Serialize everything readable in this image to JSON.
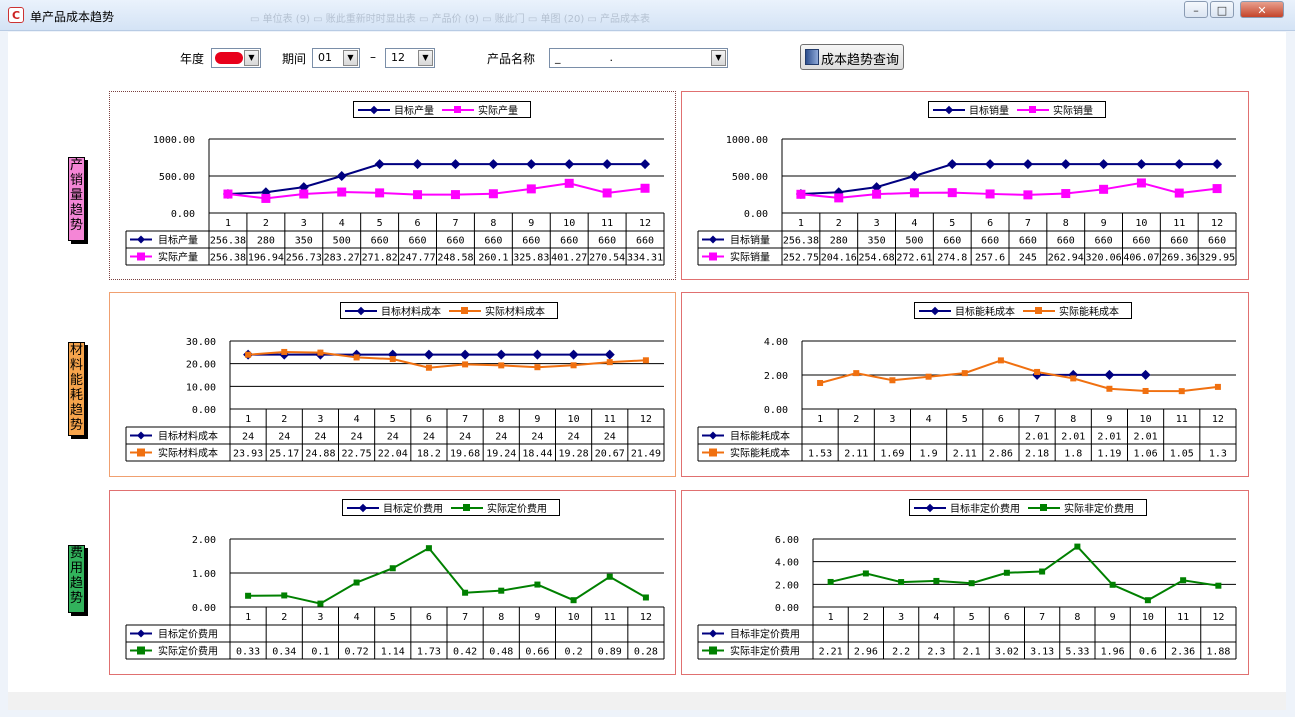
{
  "window": {
    "title": "单产品成本趋势",
    "title_icon": "app-icon",
    "bg_tabs": "▭ 单位表 (9)     ▭ 账此重新时时显出表     ▭ 产品价 (9)     ▭ 账此门     ▭ 单图 (20)     ▭ 产品成本表"
  },
  "filters": {
    "year_label": "年度",
    "period_label": "期间",
    "period_from": "01",
    "period_sep": "–",
    "period_to": "12",
    "product_label": "产品名称",
    "product_value": "_              .",
    "query_button": "成本趋势查询",
    "year_color": "#e8001b"
  },
  "sections": [
    {
      "label": "产\n销\n量\n趋\n势",
      "color": "#f486d6"
    },
    {
      "label": "材\n料\n能\n耗\n趋\n势",
      "color": "#f6a44c"
    },
    {
      "label": "费\n用\n趋\n势",
      "color": "#32b35c"
    }
  ],
  "panels": [
    {
      "id": "production",
      "border_color": "#7a4040",
      "dotted": true,
      "legend": [
        "目标产量",
        "实际产量"
      ],
      "chart_data": {
        "type": "line",
        "categories": [
          "1",
          "2",
          "3",
          "4",
          "5",
          "6",
          "7",
          "8",
          "9",
          "10",
          "11",
          "12"
        ],
        "yticks": [
          "1000.00",
          "500.00",
          "0.00"
        ],
        "ylim": [
          0,
          1000
        ],
        "series": [
          {
            "name": "目标产量",
            "color": "#000080",
            "marker": "diamond",
            "values": [
              256.38,
              280,
              350,
              500,
              660,
              660,
              660,
              660,
              660,
              660,
              660,
              660
            ],
            "labels": [
              "256.38",
              "280",
              "350",
              "500",
              "660",
              "660",
              "660",
              "660",
              "660",
              "660",
              "660",
              "660"
            ]
          },
          {
            "name": "实际产量",
            "color": "#ff00ff",
            "marker": "square",
            "values": [
              256.38,
              196.94,
              256.73,
              283.27,
              271.82,
              247.77,
              248.58,
              260.1,
              325.83,
              401.27,
              270.54,
              334.31
            ],
            "labels": [
              "256.38",
              "196.94",
              "256.73",
              "283.27",
              "271.82",
              "247.77",
              "248.58",
              "260.1",
              "325.83",
              "401.27",
              "270.54",
              "334.31"
            ]
          }
        ]
      }
    },
    {
      "id": "sales",
      "border_color": "#e07070",
      "dotted": false,
      "legend": [
        "目标销量",
        "实际销量"
      ],
      "chart_data": {
        "type": "line",
        "categories": [
          "1",
          "2",
          "3",
          "4",
          "5",
          "6",
          "7",
          "8",
          "9",
          "10",
          "11",
          "12"
        ],
        "yticks": [
          "1000.00",
          "500.00",
          "0.00"
        ],
        "ylim": [
          0,
          1000
        ],
        "series": [
          {
            "name": "目标销量",
            "color": "#000080",
            "marker": "diamond",
            "values": [
              256.38,
              280,
              350,
              500,
              660,
              660,
              660,
              660,
              660,
              660,
              660,
              660
            ],
            "labels": [
              "256.38",
              "280",
              "350",
              "500",
              "660",
              "660",
              "660",
              "660",
              "660",
              "660",
              "660",
              "660"
            ]
          },
          {
            "name": "实际销量",
            "color": "#ff00ff",
            "marker": "square",
            "values": [
              252.75,
              204.16,
              254.68,
              272.61,
              274.8,
              257.6,
              245,
              262.94,
              320.06,
              406.07,
              269.36,
              329.95
            ],
            "labels": [
              "252.75",
              "204.16",
              "254.68",
              "272.61",
              "274.8",
              "257.6",
              "245",
              "262.94",
              "320.06",
              "406.07",
              "269.36",
              "329.95"
            ]
          }
        ]
      }
    },
    {
      "id": "material",
      "border_color": "#f0a070",
      "dotted": false,
      "legend": [
        "目标材料成本",
        "实际材料成本"
      ],
      "chart_data": {
        "type": "line",
        "categories": [
          "1",
          "2",
          "3",
          "4",
          "5",
          "6",
          "7",
          "8",
          "9",
          "10",
          "11",
          "12"
        ],
        "yticks": [
          "30.00",
          "20.00",
          "10.00",
          "0.00"
        ],
        "ylim": [
          0,
          30
        ],
        "series": [
          {
            "name": "目标材料成本",
            "color": "#000080",
            "marker": "diamond",
            "values": [
              24,
              24,
              24,
              24,
              24,
              24,
              24,
              24,
              24,
              24,
              24,
              null
            ],
            "labels": [
              "24",
              "24",
              "24",
              "24",
              "24",
              "24",
              "24",
              "24",
              "24",
              "24",
              "24",
              ""
            ]
          },
          {
            "name": "实际材料成本",
            "color": "#f07010",
            "marker": "square",
            "values": [
              23.93,
              25.17,
              24.88,
              22.75,
              22.04,
              18.2,
              19.68,
              19.24,
              18.44,
              19.28,
              20.67,
              21.49
            ],
            "labels": [
              "23.93",
              "25.17",
              "24.88",
              "22.75",
              "22.04",
              "18.2",
              "19.68",
              "19.24",
              "18.44",
              "19.28",
              "20.67",
              "21.49"
            ]
          }
        ]
      }
    },
    {
      "id": "energy",
      "border_color": "#e07070",
      "dotted": false,
      "legend": [
        "目标能耗成本",
        "实际能耗成本"
      ],
      "chart_data": {
        "type": "line",
        "categories": [
          "1",
          "2",
          "3",
          "4",
          "5",
          "6",
          "7",
          "8",
          "9",
          "10",
          "11",
          "12"
        ],
        "yticks": [
          "4.00",
          "2.00",
          "0.00"
        ],
        "ylim": [
          0,
          4
        ],
        "series": [
          {
            "name": "目标能耗成本",
            "color": "#000080",
            "marker": "diamond",
            "values": [
              null,
              null,
              null,
              null,
              null,
              null,
              2.01,
              2.01,
              2.01,
              2.01,
              null,
              null
            ],
            "labels": [
              "",
              "",
              "",
              "",
              "",
              "",
              "2.01",
              "2.01",
              "2.01",
              "2.01",
              "",
              ""
            ]
          },
          {
            "name": "实际能耗成本",
            "color": "#f07010",
            "marker": "square",
            "values": [
              1.53,
              2.11,
              1.69,
              1.9,
              2.11,
              2.86,
              2.18,
              1.8,
              1.19,
              1.06,
              1.05,
              1.3
            ],
            "labels": [
              "1.53",
              "2.11",
              "1.69",
              "1.9",
              "2.11",
              "2.86",
              "2.18",
              "1.8",
              "1.19",
              "1.06",
              "1.05",
              "1.3"
            ]
          }
        ]
      }
    },
    {
      "id": "fixed-fee",
      "border_color": "#e07070",
      "dotted": false,
      "legend": [
        "目标定价费用",
        "实际定价费用"
      ],
      "chart_data": {
        "type": "line",
        "categories": [
          "1",
          "2",
          "3",
          "4",
          "5",
          "6",
          "7",
          "8",
          "9",
          "10",
          "11",
          "12"
        ],
        "yticks": [
          "2.00",
          "1.00",
          "0.00"
        ],
        "ylim": [
          0,
          2
        ],
        "series": [
          {
            "name": "目标定价费用",
            "color": "#000080",
            "marker": "diamond",
            "values": [
              null,
              null,
              null,
              null,
              null,
              null,
              null,
              null,
              null,
              null,
              null,
              null
            ],
            "labels": [
              "",
              "",
              "",
              "",
              "",
              "",
              "",
              "",
              "",
              "",
              "",
              ""
            ]
          },
          {
            "name": "实际定价费用",
            "color": "#008000",
            "marker": "square",
            "values": [
              0.33,
              0.34,
              0.1,
              0.72,
              1.14,
              1.73,
              0.42,
              0.48,
              0.66,
              0.2,
              0.89,
              0.28
            ],
            "labels": [
              "0.33",
              "0.34",
              "0.1",
              "0.72",
              "1.14",
              "1.73",
              "0.42",
              "0.48",
              "0.66",
              "0.2",
              "0.89",
              "0.28"
            ]
          }
        ]
      }
    },
    {
      "id": "nonfixed-fee",
      "border_color": "#e07070",
      "dotted": false,
      "legend": [
        "目标非定价费用",
        "实际非定价费用"
      ],
      "chart_data": {
        "type": "line",
        "categories": [
          "1",
          "2",
          "3",
          "4",
          "5",
          "6",
          "7",
          "8",
          "9",
          "10",
          "11",
          "12"
        ],
        "yticks": [
          "6.00",
          "4.00",
          "2.00",
          "0.00"
        ],
        "ylim": [
          0,
          6
        ],
        "series": [
          {
            "name": "目标非定价费用",
            "color": "#000080",
            "marker": "diamond",
            "values": [
              null,
              null,
              null,
              null,
              null,
              null,
              null,
              null,
              null,
              null,
              null,
              null
            ],
            "labels": [
              "",
              "",
              "",
              "",
              "",
              "",
              "",
              "",
              "",
              "",
              "",
              ""
            ]
          },
          {
            "name": "实际非定价费用",
            "color": "#008000",
            "marker": "square",
            "values": [
              2.21,
              2.96,
              2.2,
              2.3,
              2.1,
              3.02,
              3.13,
              5.33,
              1.96,
              0.6,
              2.36,
              1.88
            ],
            "labels": [
              "2.21",
              "2.96",
              "2.2",
              "2.3",
              "2.1",
              "3.02",
              "3.13",
              "5.33",
              "1.96",
              "0.6",
              "2.36",
              "1.88"
            ]
          }
        ]
      }
    }
  ]
}
